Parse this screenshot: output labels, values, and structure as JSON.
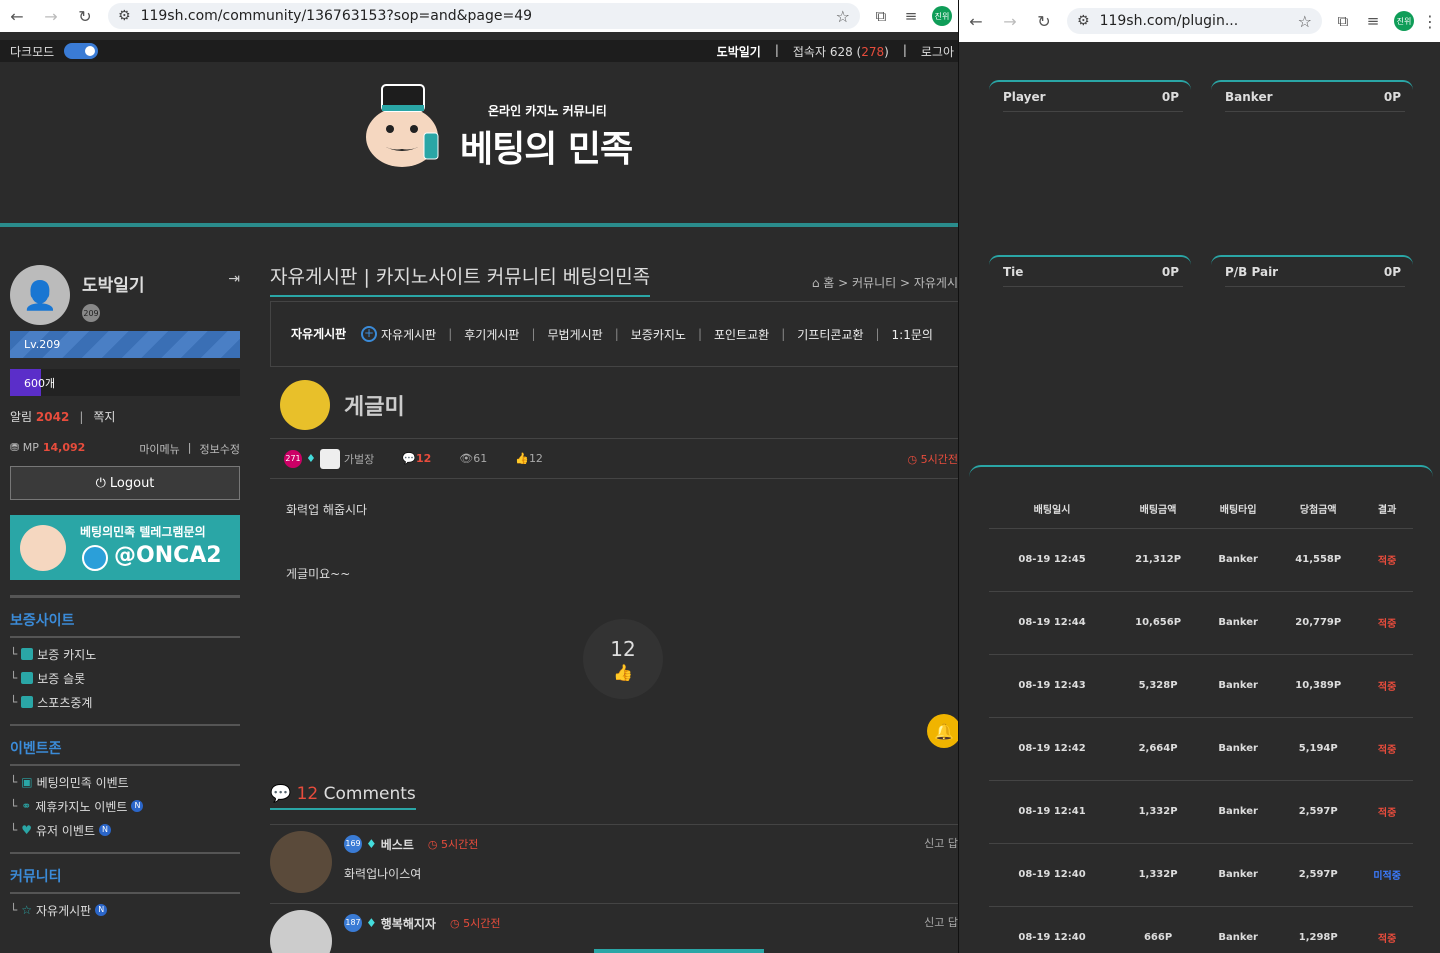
{
  "left_browser": {
    "url": "119sh.com/community/136763153?sop=and&page=49",
    "profile_initial": "진위"
  },
  "right_browser": {
    "url": "119sh.com/plugin...",
    "profile_initial": "진위"
  },
  "topbar": {
    "dark_mode_label": "다크모드",
    "dark_mode_on": true,
    "user_link": "도박일기",
    "visitors_label": "접속자 628",
    "visitors_highlight": "278",
    "logout_link": "로그아"
  },
  "header": {
    "logo_tagline": "온라인 카지노 커뮤니티",
    "logo_title": "베팅의 민족"
  },
  "sidebar": {
    "username": "도박일기",
    "level_badge": "209",
    "level_label": "Lv.209",
    "points_label": "600개",
    "alerts_label": "알림",
    "alerts_count": "2042",
    "messages_label": "쪽지",
    "mp_label": "MP",
    "mp_value": "14,092",
    "my_menu": "마이메뉴",
    "edit_info": "정보수정",
    "logout_button": "Logout",
    "banner_line1": "베팅의민족 텔레그램문의",
    "banner_line2": "@ONCA2",
    "section1_title": "보증사이트",
    "section1_items": [
      "보증 카지노",
      "보증 슬롯",
      "스포츠중계"
    ],
    "section2_title": "이벤트존",
    "section2_items": [
      "베팅의민족 이벤트",
      "제휴카지노 이벤트",
      "유저 이벤트"
    ],
    "section3_title": "커뮤니티",
    "section3_items": [
      "자유게시판"
    ],
    "new_badge": "N"
  },
  "content": {
    "page_title": "자유게시판 | 카지노사이트 커뮤니티 베팅의민족",
    "breadcrumb": "홈 > 커뮤니티 > 자유게시",
    "subnav_current": "자유게시판",
    "subnav_links": [
      "자유게시판",
      "후기게시판",
      "무법게시판",
      "보증카지노",
      "포인트교환",
      "기프티콘교환",
      "1:1문의"
    ],
    "author_name": "게글미",
    "meta_level": "271",
    "meta_user": "가벌장",
    "meta_comments": "12",
    "meta_views": "61",
    "meta_likes": "12",
    "meta_time": "5시간전",
    "body_line1": "화력업 해줍시다",
    "body_line2": "게글미요~~",
    "like_count": "12",
    "comments_count": "12",
    "comments_label": "Comments",
    "comments": [
      {
        "level": "169",
        "name": "베스트",
        "time": "5시간전",
        "text": "화력업나이스여",
        "actions": "신고 답"
      },
      {
        "level": "187",
        "name": "행복해지자",
        "time": "5시간전",
        "text": "",
        "actions": "신고 답"
      }
    ]
  },
  "betting": {
    "cards": [
      {
        "label": "Player",
        "value": "0P"
      },
      {
        "label": "Banker",
        "value": "0P"
      },
      {
        "label": "Tie",
        "value": "0P"
      },
      {
        "label": "P/B Pair",
        "value": "0P"
      }
    ],
    "headers": [
      "배팅일시",
      "배팅금액",
      "배팅타입",
      "당첨금액",
      "결과"
    ],
    "rows": [
      {
        "time": "08-19 12:45",
        "amount": "21,312P",
        "type": "Banker",
        "win": "41,558P",
        "result": "적중",
        "hit": true
      },
      {
        "time": "08-19 12:44",
        "amount": "10,656P",
        "type": "Banker",
        "win": "20,779P",
        "result": "적중",
        "hit": true
      },
      {
        "time": "08-19 12:43",
        "amount": "5,328P",
        "type": "Banker",
        "win": "10,389P",
        "result": "적중",
        "hit": true
      },
      {
        "time": "08-19 12:42",
        "amount": "2,664P",
        "type": "Banker",
        "win": "5,194P",
        "result": "적중",
        "hit": true
      },
      {
        "time": "08-19 12:41",
        "amount": "1,332P",
        "type": "Banker",
        "win": "2,597P",
        "result": "적중",
        "hit": true
      },
      {
        "time": "08-19 12:40",
        "amount": "1,332P",
        "type": "Banker",
        "win": "2,597P",
        "result": "미적중",
        "hit": false
      },
      {
        "time": "08-19 12:40",
        "amount": "666P",
        "type": "Banker",
        "win": "1,298P",
        "result": "적중",
        "hit": true
      }
    ],
    "colors": {
      "hit": "#e74c3c",
      "miss": "#3b7bff",
      "accent": "#2aa6a6"
    }
  }
}
